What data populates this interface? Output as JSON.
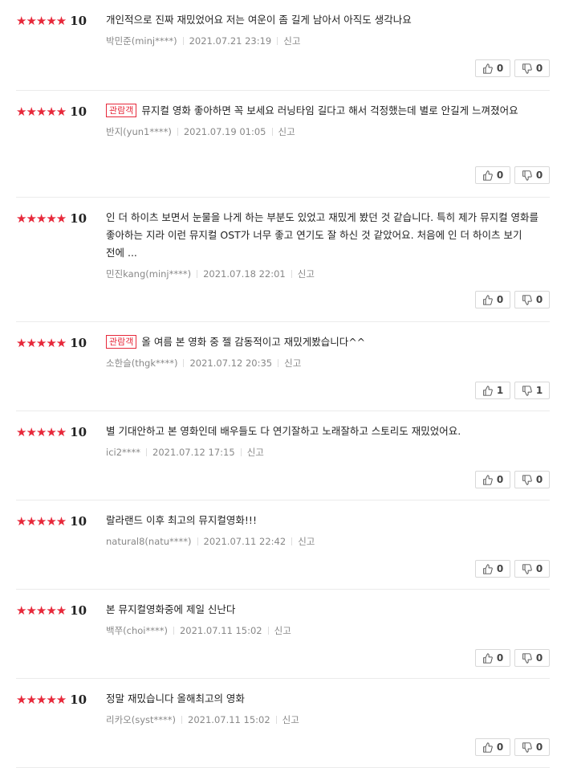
{
  "icons": {
    "star": "star-icon",
    "like": "thumbs-up-icon",
    "dislike": "thumbs-down-icon"
  },
  "colors": {
    "star": "#e7283a",
    "badge": "#e7283a"
  },
  "reviews": [
    {
      "stars": "★★★★★",
      "score": "10",
      "badge": "",
      "text": "개인적으로 진짜 재밌었어요 저는 여운이 좀 길게 남아서 아직도 생각나요",
      "user": "박민준(minj****)",
      "date": "2021.07.21 23:19",
      "report": "신고",
      "likes": "0",
      "dislikes": "0"
    },
    {
      "stars": "★★★★★",
      "score": "10",
      "badge": "관람객",
      "text": "뮤지컬 영화 좋아하면 꼭 보세요 러닝타임 길다고 해서 걱정했는데 별로 안길게 느껴졌어요",
      "user": "반지(yun1****)",
      "date": "2021.07.19 01:05",
      "report": "신고",
      "likes": "0",
      "dislikes": "0"
    },
    {
      "stars": "★★★★★",
      "score": "10",
      "badge": "",
      "text": "인 더 하이츠 보면서 눈물을 나게 하는 부분도 있었고 재밌게 봤던 것 같습니다. 특히 제가 뮤지컬 영화를 좋아하는 지라 이런 뮤지컬 OST가 너무 좋고 연기도 잘 하신 것 같았어요. 처음에 인 더 하이츠 보기 전에 ...",
      "user": "민진kang(minj****)",
      "date": "2021.07.18 22:01",
      "report": "신고",
      "likes": "0",
      "dislikes": "0"
    },
    {
      "stars": "★★★★★",
      "score": "10",
      "badge": "관람객",
      "text": "올 여름 본 영화 중 젤 감동적이고 재밌게봤습니다^^",
      "user": "소한슬(thgk****)",
      "date": "2021.07.12 20:35",
      "report": "신고",
      "likes": "1",
      "dislikes": "1"
    },
    {
      "stars": "★★★★★",
      "score": "10",
      "badge": "",
      "text": "별 기대안하고 본 영화인데 배우들도 다 연기잘하고 노래잘하고 스토리도 재밌었어요.",
      "user": "ici2****",
      "date": "2021.07.12 17:15",
      "report": "신고",
      "likes": "0",
      "dislikes": "0"
    },
    {
      "stars": "★★★★★",
      "score": "10",
      "badge": "",
      "text": "랄라랜드 이후 최고의 뮤지컬영화!!!",
      "user": "natural8(natu****)",
      "date": "2021.07.11 22:42",
      "report": "신고",
      "likes": "0",
      "dislikes": "0"
    },
    {
      "stars": "★★★★★",
      "score": "10",
      "badge": "",
      "text": "본 뮤지컬영화중에 제일 신난다",
      "user": "백쭈(choi****)",
      "date": "2021.07.11 15:02",
      "report": "신고",
      "likes": "0",
      "dislikes": "0"
    },
    {
      "stars": "★★★★★",
      "score": "10",
      "badge": "",
      "text": "정말 재밌습니다 올해최고의 영화",
      "user": "리카오(syst****)",
      "date": "2021.07.11 15:02",
      "report": "신고",
      "likes": "0",
      "dislikes": "0"
    }
  ]
}
